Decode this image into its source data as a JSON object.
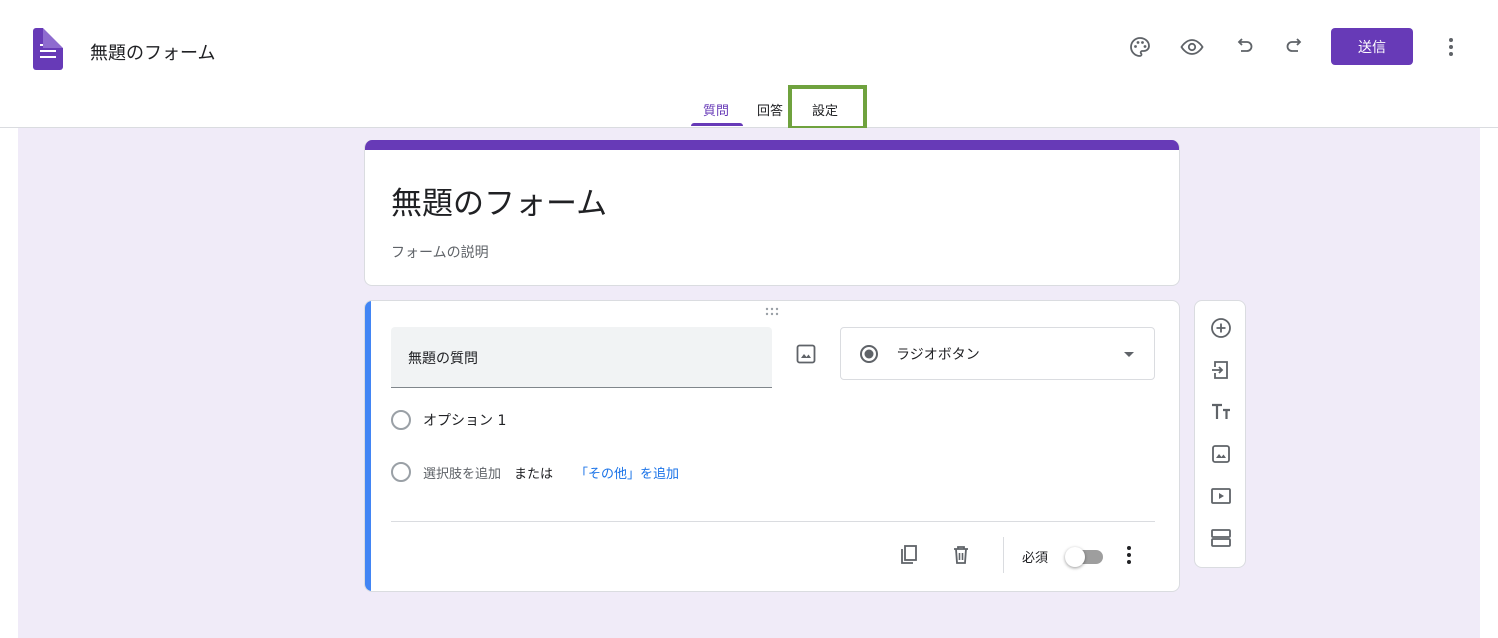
{
  "header": {
    "doc_title": "無題のフォーム",
    "send_label": "送信",
    "icons": [
      "palette-icon",
      "eye-icon",
      "undo-icon",
      "redo-icon",
      "more-vert-icon"
    ]
  },
  "tabs": [
    {
      "label": "質問",
      "active": true
    },
    {
      "label": "回答",
      "active": false
    },
    {
      "label": "設定",
      "active": false
    }
  ],
  "form": {
    "title": "無題のフォーム",
    "description_placeholder": "フォームの説明"
  },
  "question": {
    "title": "無題の質問",
    "type_label": "ラジオボタン",
    "options": [
      "オプション 1"
    ],
    "add_option": "選択肢を追加",
    "or_text": "または",
    "add_other": "「その他」を追加",
    "required_label": "必須",
    "required": false
  },
  "side_toolbar": {
    "icons": [
      "add-circle-icon",
      "import-icon",
      "text-icon",
      "image-icon",
      "video-icon",
      "section-icon"
    ]
  },
  "colors": {
    "accent": "#673ab7",
    "canvas": "#f0ebf8",
    "highlight": "#6fa23e",
    "link": "#1a73e8"
  }
}
